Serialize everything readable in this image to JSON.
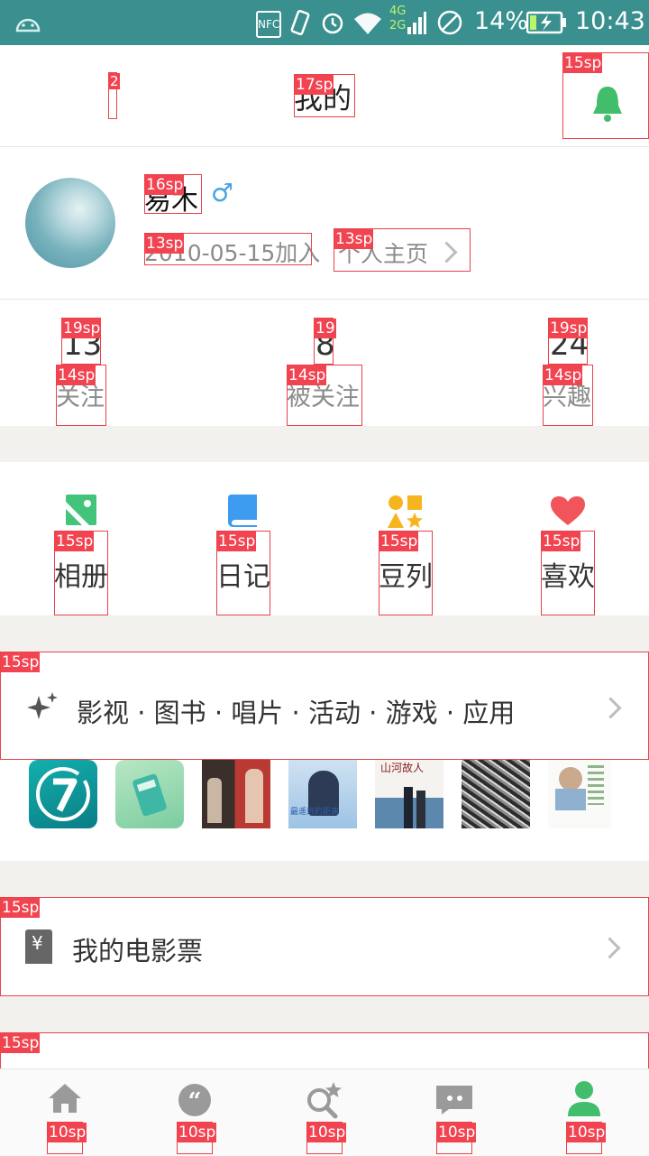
{
  "status_bar": {
    "nfc": "NFC",
    "network": "4G\n2G",
    "battery": "14%",
    "time": "10:43"
  },
  "header": {
    "title": "我的"
  },
  "profile": {
    "name": "易木",
    "gender_symbol": "♂",
    "joined": "2010-05-15加入",
    "homepage_link": "个人主页"
  },
  "stats": [
    {
      "number": "13",
      "label": "关注"
    },
    {
      "number": "8",
      "label": "被关注"
    },
    {
      "number": "24",
      "label": "兴趣"
    }
  ],
  "shortcuts": [
    {
      "label": "相册",
      "icon": "album-icon",
      "color": "#42c57a"
    },
    {
      "label": "日记",
      "icon": "diary-icon",
      "color": "#3d9bf0"
    },
    {
      "label": "豆列",
      "icon": "doulist-icon",
      "color": "#f6b51e"
    },
    {
      "label": "喜欢",
      "icon": "heart-icon",
      "color": "#f2545b"
    }
  ],
  "subjects": {
    "label": "影视 · 图书 · 唱片 · 活动 · 游戏 · 应用",
    "thumb_posters": [
      "最遥远的距离",
      "山河故人"
    ]
  },
  "tickets": {
    "label": "我的电影票",
    "currency": "¥"
  },
  "annotations": {
    "header_tag_left": "2",
    "title_tag": "17sp",
    "bell_tag": "15sp",
    "name_tag": "16sp",
    "joined_tag": "13sp",
    "homepage_tag": "13sp",
    "stat_num_tags": [
      "19sp",
      "19",
      "19sp"
    ],
    "stat_label_tag": "14sp",
    "shortcut_tag": "15sp",
    "row_tag": "15sp",
    "tab_tag": "10sp"
  },
  "colors": {
    "status_bar": "#3a8f8f",
    "accent_green": "#42bd6b",
    "annotation_red": "#f24450"
  }
}
